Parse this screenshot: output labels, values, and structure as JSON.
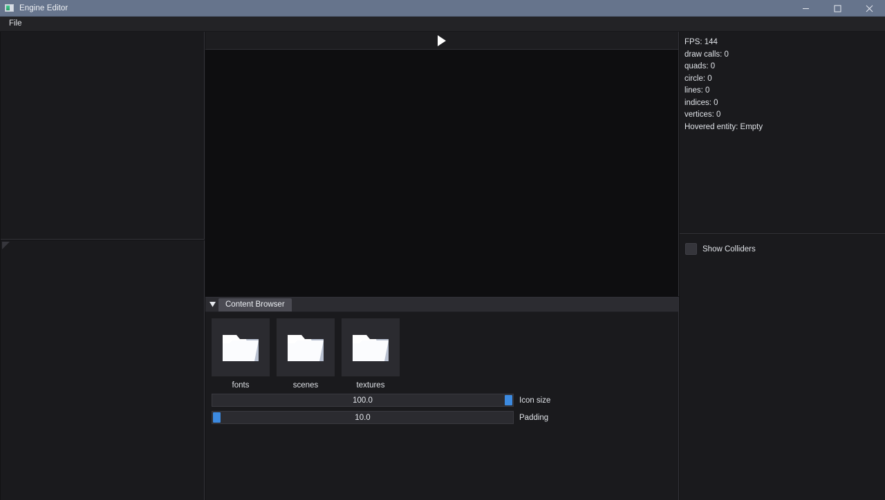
{
  "window": {
    "title": "Engine Editor",
    "icon": "app-icon",
    "controls": [
      {
        "name": "minimize",
        "glyph": "minimize-icon"
      },
      {
        "name": "maximize",
        "glyph": "maximize-icon"
      },
      {
        "name": "close",
        "glyph": "close-icon"
      }
    ]
  },
  "menubar": {
    "items": [
      {
        "label": "File"
      }
    ]
  },
  "viewport": {
    "play_button": "play-icon"
  },
  "content_browser": {
    "collapse_icon": "collapse-triangle-icon",
    "tab_label": "Content Browser",
    "items": [
      {
        "label": "fonts",
        "icon": "folder-icon"
      },
      {
        "label": "scenes",
        "icon": "folder-icon"
      },
      {
        "label": "textures",
        "icon": "folder-icon"
      }
    ],
    "sliders": [
      {
        "label": "Icon size",
        "value": "100.0",
        "fill_percent": 98
      },
      {
        "label": "Padding",
        "value": "10.0",
        "fill_percent": 1
      }
    ]
  },
  "stats": {
    "lines": [
      "FPS: 144",
      "draw calls: 0",
      "quads: 0",
      "circle: 0",
      "lines: 0",
      "indices: 0",
      "vertices: 0",
      "Hovered entity: Empty"
    ]
  },
  "settings": {
    "show_colliders": {
      "label": "Show Colliders",
      "checked": false
    }
  },
  "colors": {
    "titlebar": "#66748c",
    "accent": "#3c8ae0",
    "panel_bg": "#1a1a1d",
    "viewport_bg": "#0e0e10",
    "tab_active": "#4a4a52"
  }
}
